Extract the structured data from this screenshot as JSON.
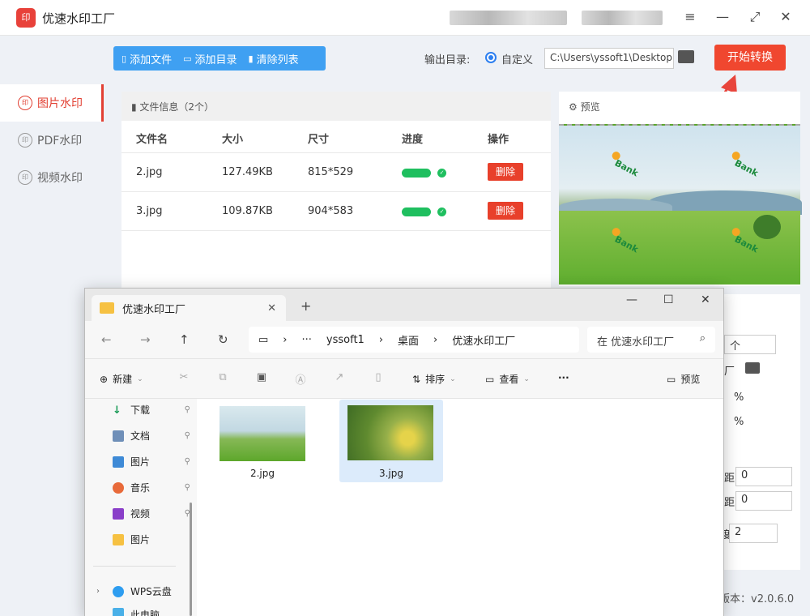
{
  "app": {
    "logo": "印",
    "title": "优速水印工厂",
    "window_controls": [
      "≡",
      "—",
      "⤢",
      "✕"
    ]
  },
  "sidebar": {
    "items": [
      {
        "label": "图片水印",
        "icon": "印",
        "active": true
      },
      {
        "label": "PDF水印",
        "icon": "印",
        "active": false
      },
      {
        "label": "视频水印",
        "icon": "印",
        "active": false
      }
    ]
  },
  "toolbar": {
    "add_file": "添加文件",
    "add_dir": "添加目录",
    "clear_list": "清除列表"
  },
  "output": {
    "label": "输出目录:",
    "option": "自定义",
    "path": "C:\\Users\\yssoft1\\Desktop",
    "start_label": "开始转换"
  },
  "file_panel": {
    "header": "文件信息（2个）",
    "columns": [
      "文件名",
      "大小",
      "尺寸",
      "进度",
      "操作"
    ],
    "rows": [
      {
        "name": "2.jpg",
        "size": "127.49KB",
        "dims": "815*529",
        "progress": 1.0,
        "action": "删除"
      },
      {
        "name": "3.jpg",
        "size": "109.87KB",
        "dims": "904*583",
        "progress": 1.0,
        "action": "删除"
      }
    ]
  },
  "preview": {
    "title": "预览",
    "watermark_text": "Bank"
  },
  "settings": {
    "percent": "%",
    "frag_1": "个",
    "frag_2": "厂",
    "frag_3": "距",
    "frag_4": "距",
    "frag_5": "度",
    "value_1": "0",
    "value_2": "0",
    "value_3": "2"
  },
  "version": "版本：v2.0.6.0",
  "explorer": {
    "tab_title": "优速水印工厂",
    "new_tab": "+",
    "breadcrumb": [
      "yssoft1",
      "桌面",
      "优速水印工厂"
    ],
    "search_placeholder": "在 优速水印工厂",
    "commands": {
      "new": "新建",
      "sort": "排序",
      "view": "查看",
      "more": "···",
      "preview": "预览"
    },
    "nav_items": [
      "下载",
      "文档",
      "图片",
      "音乐",
      "视频",
      "图片"
    ],
    "nav_items_bottom": [
      "WPS云盘",
      "此电脑"
    ],
    "files": [
      "2.jpg",
      "3.jpg"
    ]
  },
  "colors": {
    "accent": "#f0472f",
    "toolbar": "#3fa0f2",
    "progress": "#1fbf5f"
  }
}
